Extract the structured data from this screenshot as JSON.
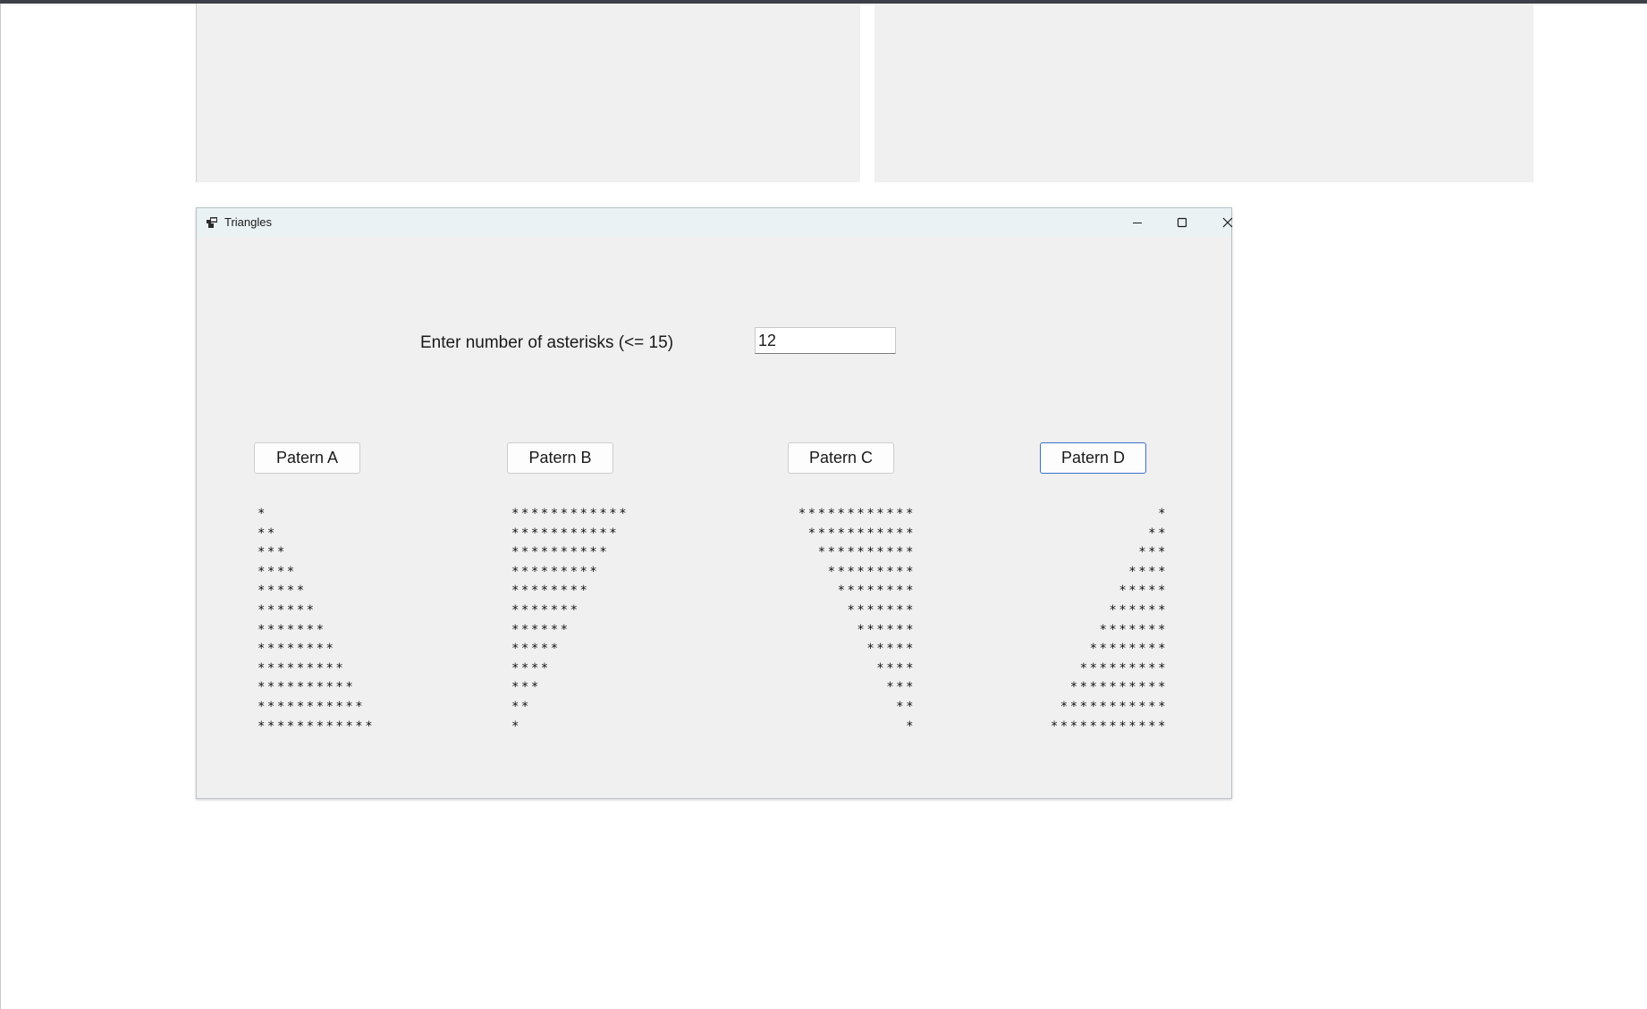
{
  "window": {
    "title": "Triangles",
    "icons": {
      "app": "app-icon",
      "minimize": "minimize-icon",
      "maximize": "maximize-icon",
      "close": "close-icon"
    }
  },
  "form": {
    "prompt": "Enter number of asterisks (<= 15)",
    "asterisk_count": "12"
  },
  "buttons": {
    "pattern_a": "Patern A",
    "pattern_b": "Patern B",
    "pattern_c": "Patern C",
    "pattern_d": "Patern D"
  },
  "outputs": {
    "pattern_a": "*\n**\n***\n****\n*****\n******\n*******\n********\n*********\n**********\n***********\n************",
    "pattern_b": "************\n***********\n**********\n*********\n********\n*******\n******\n*****\n****\n***\n**\n*",
    "pattern_c": "************\n***********\n**********\n*********\n********\n*******\n******\n*****\n****\n***\n**\n*",
    "pattern_d": "*\n**\n***\n****\n*****\n******\n*******\n********\n*********\n**********\n***********\n************"
  },
  "colors": {
    "window_background": "#f0f0f0",
    "titlebar": "#eaf2f3",
    "focus_border": "#3b6ec9"
  }
}
